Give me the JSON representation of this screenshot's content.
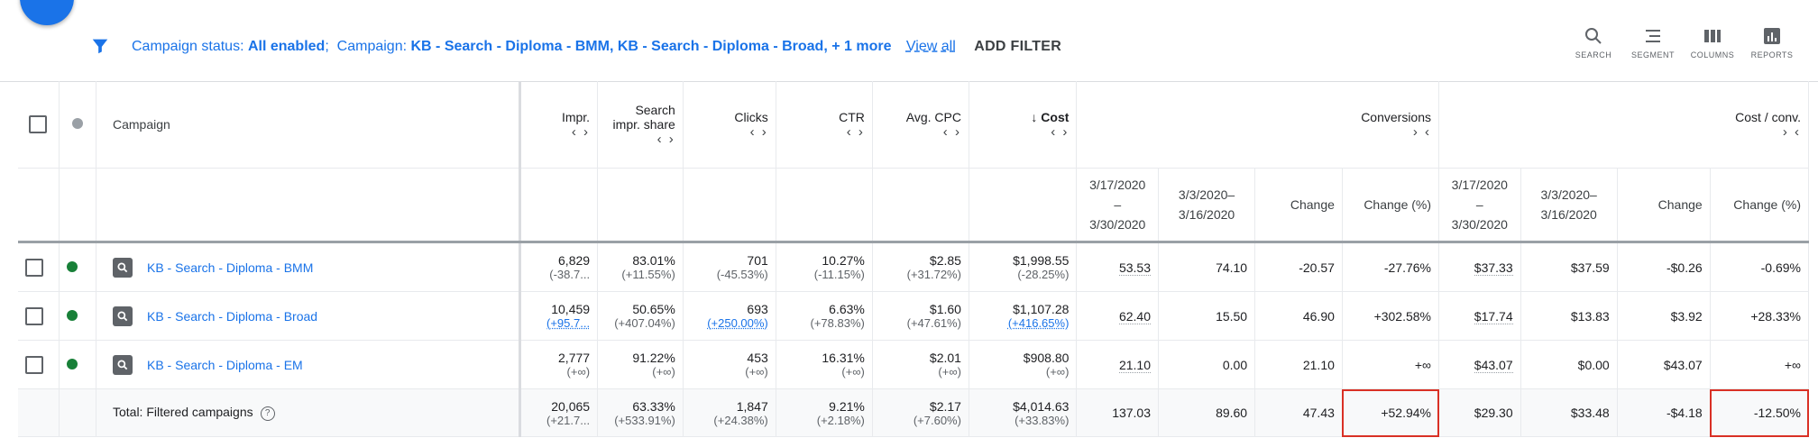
{
  "filter_bar": {
    "status_label": "Campaign status: ",
    "status_value": "All enabled",
    "campaign_label": "Campaign: ",
    "campaign_value": "KB - Search - Diploma - BMM, KB - Search - Diploma - Broad, + 1 more",
    "view_all": "View all",
    "add_filter": "ADD FILTER"
  },
  "tools": [
    {
      "label": "SEARCH",
      "icon": "search-icon"
    },
    {
      "label": "SEGMENT",
      "icon": "segment-icon"
    },
    {
      "label": "COLUMNS",
      "icon": "columns-icon"
    },
    {
      "label": "REPORTS",
      "icon": "reports-icon"
    }
  ],
  "columns": {
    "campaign": "Campaign",
    "impr": "Impr.",
    "search_impr_share_1": "Search",
    "search_impr_share_2": "impr. share",
    "clicks": "Clicks",
    "ctr": "CTR",
    "avg_cpc": "Avg. CPC",
    "cost": "Cost",
    "conversions": "Conversions",
    "cost_per_conv": "Cost / conv.",
    "expand_arrows": "‹ ›",
    "collapse_arrows": "› ‹"
  },
  "subcolumns": {
    "range_a_1": "3/17/2020",
    "range_a_2": "–",
    "range_a_3": "3/30/2020",
    "range_b_1": "3/3/2020–",
    "range_b_2": "3/16/2020",
    "change": "Change",
    "change_pct": "Change (%)"
  },
  "rows": [
    {
      "name": "KB - Search - Diploma - BMM",
      "impr": "6,829",
      "impr_sub": "(-38.7...",
      "share": "83.01%",
      "share_sub": "(+11.55%)",
      "clicks": "701",
      "clicks_sub": "(-45.53%)",
      "ctr": "10.27%",
      "ctr_sub": "(-11.15%)",
      "cpc": "$2.85",
      "cpc_sub": "(+31.72%)",
      "cost": "$1,998.55",
      "cost_sub": "(-28.25%)",
      "conv_a": "53.53",
      "conv_b": "74.10",
      "conv_chg": "-20.57",
      "conv_pct": "-27.76%",
      "cpa_a": "$37.33",
      "cpa_b": "$37.59",
      "cpa_chg": "-$0.26",
      "cpa_pct": "-0.69%"
    },
    {
      "name": "KB - Search - Diploma - Broad",
      "impr": "10,459",
      "impr_sub": "(+95.7...",
      "share": "50.65%",
      "share_sub": "(+407.04%)",
      "clicks": "693",
      "clicks_sub": "(+250.00%)",
      "ctr": "6.63%",
      "ctr_sub": "(+78.83%)",
      "cpc": "$1.60",
      "cpc_sub": "(+47.61%)",
      "cost": "$1,107.28",
      "cost_sub": "(+416.65%)",
      "conv_a": "62.40",
      "conv_b": "15.50",
      "conv_chg": "46.90",
      "conv_pct": "+302.58%",
      "cpa_a": "$17.74",
      "cpa_b": "$13.83",
      "cpa_chg": "$3.92",
      "cpa_pct": "+28.33%"
    },
    {
      "name": "KB - Search - Diploma - EM",
      "impr": "2,777",
      "impr_sub": "(+∞)",
      "share": "91.22%",
      "share_sub": "(+∞)",
      "clicks": "453",
      "clicks_sub": "(+∞)",
      "ctr": "16.31%",
      "ctr_sub": "(+∞)",
      "cpc": "$2.01",
      "cpc_sub": "(+∞)",
      "cost": "$908.80",
      "cost_sub": "(+∞)",
      "conv_a": "21.10",
      "conv_b": "0.00",
      "conv_chg": "21.10",
      "conv_pct": "+∞",
      "cpa_a": "$43.07",
      "cpa_b": "$0.00",
      "cpa_chg": "$43.07",
      "cpa_pct": "+∞"
    }
  ],
  "total": {
    "label": "Total: Filtered campaigns",
    "impr": "20,065",
    "impr_sub": "(+21.7...",
    "share": "63.33%",
    "share_sub": "(+533.91%)",
    "clicks": "1,847",
    "clicks_sub": "(+24.38%)",
    "ctr": "9.21%",
    "ctr_sub": "(+2.18%)",
    "cpc": "$2.17",
    "cpc_sub": "(+7.60%)",
    "cost": "$4,014.63",
    "cost_sub": "(+33.83%)",
    "conv_a": "137.03",
    "conv_b": "89.60",
    "conv_chg": "47.43",
    "conv_pct": "+52.94%",
    "cpa_a": "$29.30",
    "cpa_b": "$33.48",
    "cpa_chg": "-$4.18",
    "cpa_pct": "-12.50%"
  },
  "colors": {
    "accent": "#1a73e8",
    "highlight": "#d93025",
    "enabled": "#188038"
  }
}
